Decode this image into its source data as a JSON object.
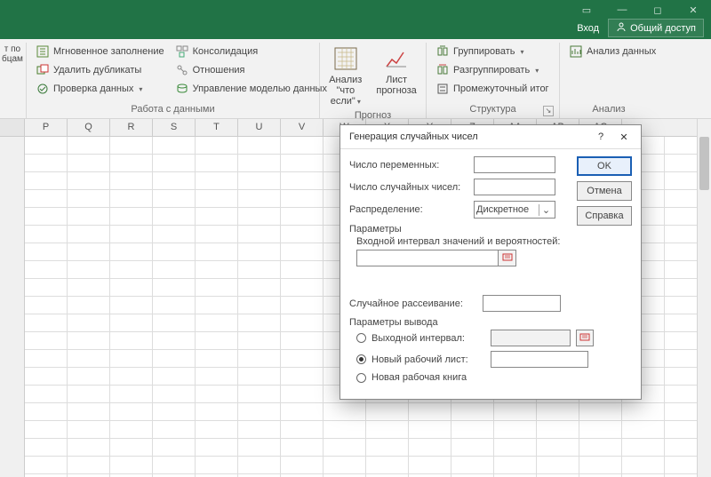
{
  "titlebar": {
    "login": "Вход",
    "shared": "Общий доступ"
  },
  "ribbon": {
    "leftFragment": {
      "line1": "т по",
      "line2": "бцам"
    },
    "data": {
      "flashFill": "Мгновенное заполнение",
      "removeDup": "Удалить дубликаты",
      "dataValidation": "Проверка данных",
      "consolidate": "Консолидация",
      "relationships": "Отношения",
      "manageModel": "Управление моделью данных",
      "groupLabel": "Работа с данными"
    },
    "forecast": {
      "whatIf1": "Анализ \"что",
      "whatIf2": "если\"",
      "sheet1": "Лист",
      "sheet2": "прогноза",
      "groupLabel": "Прогноз"
    },
    "outline": {
      "group": "Группировать",
      "ungroup": "Разгруппировать",
      "subtotal": "Промежуточный итог",
      "groupLabel": "Структура"
    },
    "analysis": {
      "dataAnalysis": "Анализ данных",
      "groupLabel": "Анализ"
    }
  },
  "columns": [
    "P",
    "Q",
    "R",
    "S",
    "T",
    "U",
    "V",
    "W",
    "X",
    "Y",
    "Z",
    "AA",
    "AB",
    "AC"
  ],
  "dialog": {
    "title": "Генерация случайных чисел",
    "numVars": "Число переменных:",
    "numRand": "Число случайных чисел:",
    "dist": "Распределение:",
    "distValue": "Дискретное",
    "params": "Параметры",
    "inputRange": "Входной интервал значений и вероятностей:",
    "seed": "Случайное рассеивание:",
    "outParams": "Параметры вывода",
    "outRange": "Выходной интервал:",
    "newSheet": "Новый рабочий лист:",
    "newBook": "Новая рабочая книга",
    "ok": "OK",
    "cancel": "Отмена",
    "help": "Справка"
  }
}
